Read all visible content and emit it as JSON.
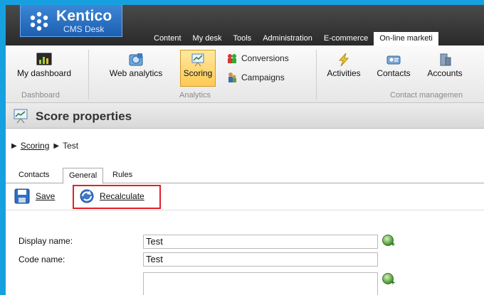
{
  "logo": {
    "title": "Kentico",
    "subtitle": "CMS Desk"
  },
  "nav_tabs": [
    "Content",
    "My desk",
    "Tools",
    "Administration",
    "E-commerce",
    "On-line marketi"
  ],
  "ribbon": {
    "my_dashboard": "My dashboard",
    "dashboard_group": "Dashboard",
    "web_analytics": "Web analytics",
    "scoring": "Scoring",
    "conversions": "Conversions",
    "campaigns": "Campaigns",
    "analytics_group": "Analytics",
    "activities": "Activities",
    "contacts": "Contacts",
    "accounts": "Accounts",
    "contact_group": "Contact managemen"
  },
  "header": {
    "title": "Score properties"
  },
  "breadcrumb": {
    "parent": "Scoring",
    "current": "Test"
  },
  "tabs": [
    "Contacts",
    "General",
    "Rules"
  ],
  "toolbar": {
    "save": "Save",
    "recalculate": "Recalculate"
  },
  "form": {
    "display_name_label": "Display name:",
    "display_name_value": "Test",
    "code_name_label": "Code name:",
    "code_name_value": "Test",
    "description_value": ""
  }
}
